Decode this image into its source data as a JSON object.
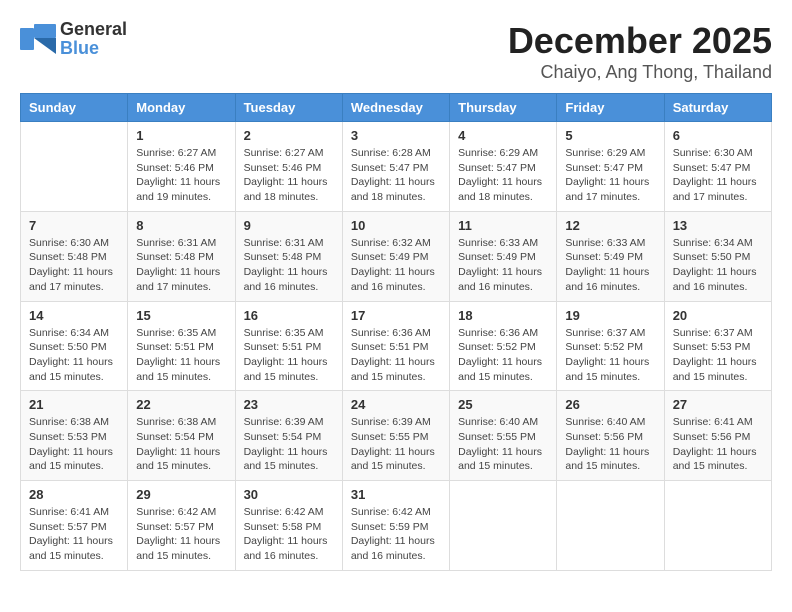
{
  "header": {
    "logo_general": "General",
    "logo_blue": "Blue",
    "month_title": "December 2025",
    "location": "Chaiyo, Ang Thong, Thailand"
  },
  "days_of_week": [
    "Sunday",
    "Monday",
    "Tuesday",
    "Wednesday",
    "Thursday",
    "Friday",
    "Saturday"
  ],
  "weeks": [
    [
      {
        "day": "",
        "info": ""
      },
      {
        "day": "1",
        "info": "Sunrise: 6:27 AM\nSunset: 5:46 PM\nDaylight: 11 hours\nand 19 minutes."
      },
      {
        "day": "2",
        "info": "Sunrise: 6:27 AM\nSunset: 5:46 PM\nDaylight: 11 hours\nand 18 minutes."
      },
      {
        "day": "3",
        "info": "Sunrise: 6:28 AM\nSunset: 5:47 PM\nDaylight: 11 hours\nand 18 minutes."
      },
      {
        "day": "4",
        "info": "Sunrise: 6:29 AM\nSunset: 5:47 PM\nDaylight: 11 hours\nand 18 minutes."
      },
      {
        "day": "5",
        "info": "Sunrise: 6:29 AM\nSunset: 5:47 PM\nDaylight: 11 hours\nand 17 minutes."
      },
      {
        "day": "6",
        "info": "Sunrise: 6:30 AM\nSunset: 5:47 PM\nDaylight: 11 hours\nand 17 minutes."
      }
    ],
    [
      {
        "day": "7",
        "info": "Sunrise: 6:30 AM\nSunset: 5:48 PM\nDaylight: 11 hours\nand 17 minutes."
      },
      {
        "day": "8",
        "info": "Sunrise: 6:31 AM\nSunset: 5:48 PM\nDaylight: 11 hours\nand 17 minutes."
      },
      {
        "day": "9",
        "info": "Sunrise: 6:31 AM\nSunset: 5:48 PM\nDaylight: 11 hours\nand 16 minutes."
      },
      {
        "day": "10",
        "info": "Sunrise: 6:32 AM\nSunset: 5:49 PM\nDaylight: 11 hours\nand 16 minutes."
      },
      {
        "day": "11",
        "info": "Sunrise: 6:33 AM\nSunset: 5:49 PM\nDaylight: 11 hours\nand 16 minutes."
      },
      {
        "day": "12",
        "info": "Sunrise: 6:33 AM\nSunset: 5:49 PM\nDaylight: 11 hours\nand 16 minutes."
      },
      {
        "day": "13",
        "info": "Sunrise: 6:34 AM\nSunset: 5:50 PM\nDaylight: 11 hours\nand 16 minutes."
      }
    ],
    [
      {
        "day": "14",
        "info": "Sunrise: 6:34 AM\nSunset: 5:50 PM\nDaylight: 11 hours\nand 15 minutes."
      },
      {
        "day": "15",
        "info": "Sunrise: 6:35 AM\nSunset: 5:51 PM\nDaylight: 11 hours\nand 15 minutes."
      },
      {
        "day": "16",
        "info": "Sunrise: 6:35 AM\nSunset: 5:51 PM\nDaylight: 11 hours\nand 15 minutes."
      },
      {
        "day": "17",
        "info": "Sunrise: 6:36 AM\nSunset: 5:51 PM\nDaylight: 11 hours\nand 15 minutes."
      },
      {
        "day": "18",
        "info": "Sunrise: 6:36 AM\nSunset: 5:52 PM\nDaylight: 11 hours\nand 15 minutes."
      },
      {
        "day": "19",
        "info": "Sunrise: 6:37 AM\nSunset: 5:52 PM\nDaylight: 11 hours\nand 15 minutes."
      },
      {
        "day": "20",
        "info": "Sunrise: 6:37 AM\nSunset: 5:53 PM\nDaylight: 11 hours\nand 15 minutes."
      }
    ],
    [
      {
        "day": "21",
        "info": "Sunrise: 6:38 AM\nSunset: 5:53 PM\nDaylight: 11 hours\nand 15 minutes."
      },
      {
        "day": "22",
        "info": "Sunrise: 6:38 AM\nSunset: 5:54 PM\nDaylight: 11 hours\nand 15 minutes."
      },
      {
        "day": "23",
        "info": "Sunrise: 6:39 AM\nSunset: 5:54 PM\nDaylight: 11 hours\nand 15 minutes."
      },
      {
        "day": "24",
        "info": "Sunrise: 6:39 AM\nSunset: 5:55 PM\nDaylight: 11 hours\nand 15 minutes."
      },
      {
        "day": "25",
        "info": "Sunrise: 6:40 AM\nSunset: 5:55 PM\nDaylight: 11 hours\nand 15 minutes."
      },
      {
        "day": "26",
        "info": "Sunrise: 6:40 AM\nSunset: 5:56 PM\nDaylight: 11 hours\nand 15 minutes."
      },
      {
        "day": "27",
        "info": "Sunrise: 6:41 AM\nSunset: 5:56 PM\nDaylight: 11 hours\nand 15 minutes."
      }
    ],
    [
      {
        "day": "28",
        "info": "Sunrise: 6:41 AM\nSunset: 5:57 PM\nDaylight: 11 hours\nand 15 minutes."
      },
      {
        "day": "29",
        "info": "Sunrise: 6:42 AM\nSunset: 5:57 PM\nDaylight: 11 hours\nand 15 minutes."
      },
      {
        "day": "30",
        "info": "Sunrise: 6:42 AM\nSunset: 5:58 PM\nDaylight: 11 hours\nand 16 minutes."
      },
      {
        "day": "31",
        "info": "Sunrise: 6:42 AM\nSunset: 5:59 PM\nDaylight: 11 hours\nand 16 minutes."
      },
      {
        "day": "",
        "info": ""
      },
      {
        "day": "",
        "info": ""
      },
      {
        "day": "",
        "info": ""
      }
    ]
  ]
}
